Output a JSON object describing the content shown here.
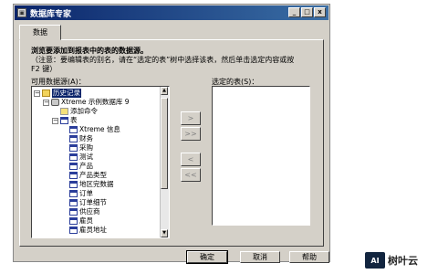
{
  "window": {
    "title": "数据库专家",
    "controls": [
      "_",
      "□",
      "x"
    ]
  },
  "tabs": [
    {
      "label": "数据"
    }
  ],
  "instructions": {
    "line1": "浏览要添加到报表中的表的数据源。",
    "line2": "（注意：要编辑表的别名，请在“选定的表”树中选择该表，然后单击选定内容或按 F2 键）"
  },
  "available": {
    "label": "可用数据源(A)：",
    "tree": [
      {
        "level": 0,
        "expander": "−",
        "icon": "folder",
        "label": "历史记录",
        "selected": true
      },
      {
        "level": 1,
        "expander": "−",
        "icon": "db",
        "label": "Xtreme 示例数据库 9"
      },
      {
        "level": 2,
        "expander": "",
        "icon": "cmd",
        "label": "添加命令"
      },
      {
        "level": 2,
        "expander": "−",
        "icon": "tbl",
        "label": "表"
      },
      {
        "level": 3,
        "expander": "",
        "icon": "tbl",
        "label": "Xtreme 信息"
      },
      {
        "level": 3,
        "expander": "",
        "icon": "tbl",
        "label": "财务"
      },
      {
        "level": 3,
        "expander": "",
        "icon": "tbl",
        "label": "采购"
      },
      {
        "level": 3,
        "expander": "",
        "icon": "tbl",
        "label": "测试"
      },
      {
        "level": 3,
        "expander": "",
        "icon": "tbl",
        "label": "产品"
      },
      {
        "level": 3,
        "expander": "",
        "icon": "tbl",
        "label": "产品类型"
      },
      {
        "level": 3,
        "expander": "",
        "icon": "tbl",
        "label": "地区完数据"
      },
      {
        "level": 3,
        "expander": "",
        "icon": "tbl",
        "label": "订单"
      },
      {
        "level": 3,
        "expander": "",
        "icon": "tbl",
        "label": "订单细节"
      },
      {
        "level": 3,
        "expander": "",
        "icon": "tbl",
        "label": "供应商"
      },
      {
        "level": 3,
        "expander": "",
        "icon": "tbl",
        "label": "雇员"
      },
      {
        "level": 3,
        "expander": "",
        "icon": "tbl",
        "label": "雇员地址"
      }
    ]
  },
  "selected": {
    "label": "选定的表(S)："
  },
  "move_buttons": {
    "add_one": ">",
    "add_all": ">>",
    "remove_one": "<",
    "remove_all": "<<"
  },
  "buttons": {
    "ok": "确定",
    "cancel": "取消",
    "help": "帮助"
  },
  "watermark": {
    "badge": "AI",
    "text": "树叶云"
  }
}
